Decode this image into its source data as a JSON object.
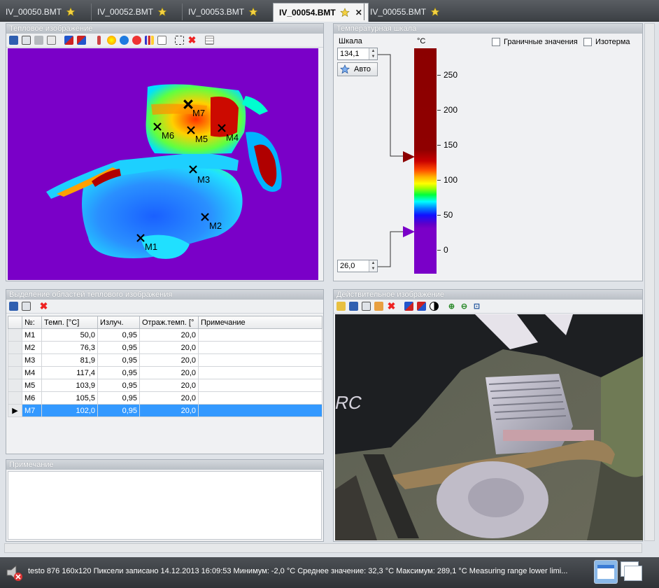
{
  "tabs": [
    {
      "label": "IV_00050.BMT",
      "active": false
    },
    {
      "label": "IV_00052.BMT",
      "active": false
    },
    {
      "label": "IV_00053.BMT",
      "active": false
    },
    {
      "label": "IV_00054.BMT",
      "active": true
    },
    {
      "label": "IV_00055.BMT",
      "active": false
    }
  ],
  "thermal_panel": {
    "title": "Тепловое изображение",
    "markers": [
      {
        "label": "M1"
      },
      {
        "label": "M2"
      },
      {
        "label": "M3"
      },
      {
        "label": "M4"
      },
      {
        "label": "M5"
      },
      {
        "label": "M6"
      },
      {
        "label": "M7"
      }
    ]
  },
  "scale_panel": {
    "title": "Температурная шкала",
    "scale_label": "Шкала",
    "max_value": "134,1",
    "min_value": "26,0",
    "auto_button": "Авто",
    "unit": "°C",
    "boundary_values_label": "Граничные значения",
    "isotherm_label": "Изотерма",
    "ticks": [
      "250",
      "200",
      "150",
      "100",
      "50",
      "0"
    ]
  },
  "regions_panel": {
    "title": "Выделение областей теплового изображения",
    "columns": [
      "№:",
      "Темп. [°C]",
      "Излуч.",
      "Отраж.темп. [°",
      "Примечание"
    ],
    "rows": [
      {
        "id": "M1",
        "temp": "50,0",
        "emis": "0,95",
        "refl": "20,0",
        "note": ""
      },
      {
        "id": "M2",
        "temp": "76,3",
        "emis": "0,95",
        "refl": "20,0",
        "note": ""
      },
      {
        "id": "M3",
        "temp": "81,9",
        "emis": "0,95",
        "refl": "20,0",
        "note": ""
      },
      {
        "id": "M4",
        "temp": "117,4",
        "emis": "0,95",
        "refl": "20,0",
        "note": ""
      },
      {
        "id": "M5",
        "temp": "103,9",
        "emis": "0,95",
        "refl": "20,0",
        "note": ""
      },
      {
        "id": "M6",
        "temp": "105,5",
        "emis": "0,95",
        "refl": "20,0",
        "note": ""
      },
      {
        "id": "M7",
        "temp": "102,0",
        "emis": "0,95",
        "refl": "20,0",
        "note": ""
      }
    ]
  },
  "note_panel": {
    "title": "Примечание"
  },
  "real_panel": {
    "title": "Действительное изображение"
  },
  "statusbar": {
    "text": "testo  876  160x120  Пиксели записано  14.12.2013  16:09:53  Минимум: -2,0 °C  Среднее значение: 32,3 °C  Максимум: 289,1 °C  Measuring range lower limi..."
  },
  "colors": {
    "accent_selection": "#3399ff",
    "background_purple": "#7a00c8"
  }
}
